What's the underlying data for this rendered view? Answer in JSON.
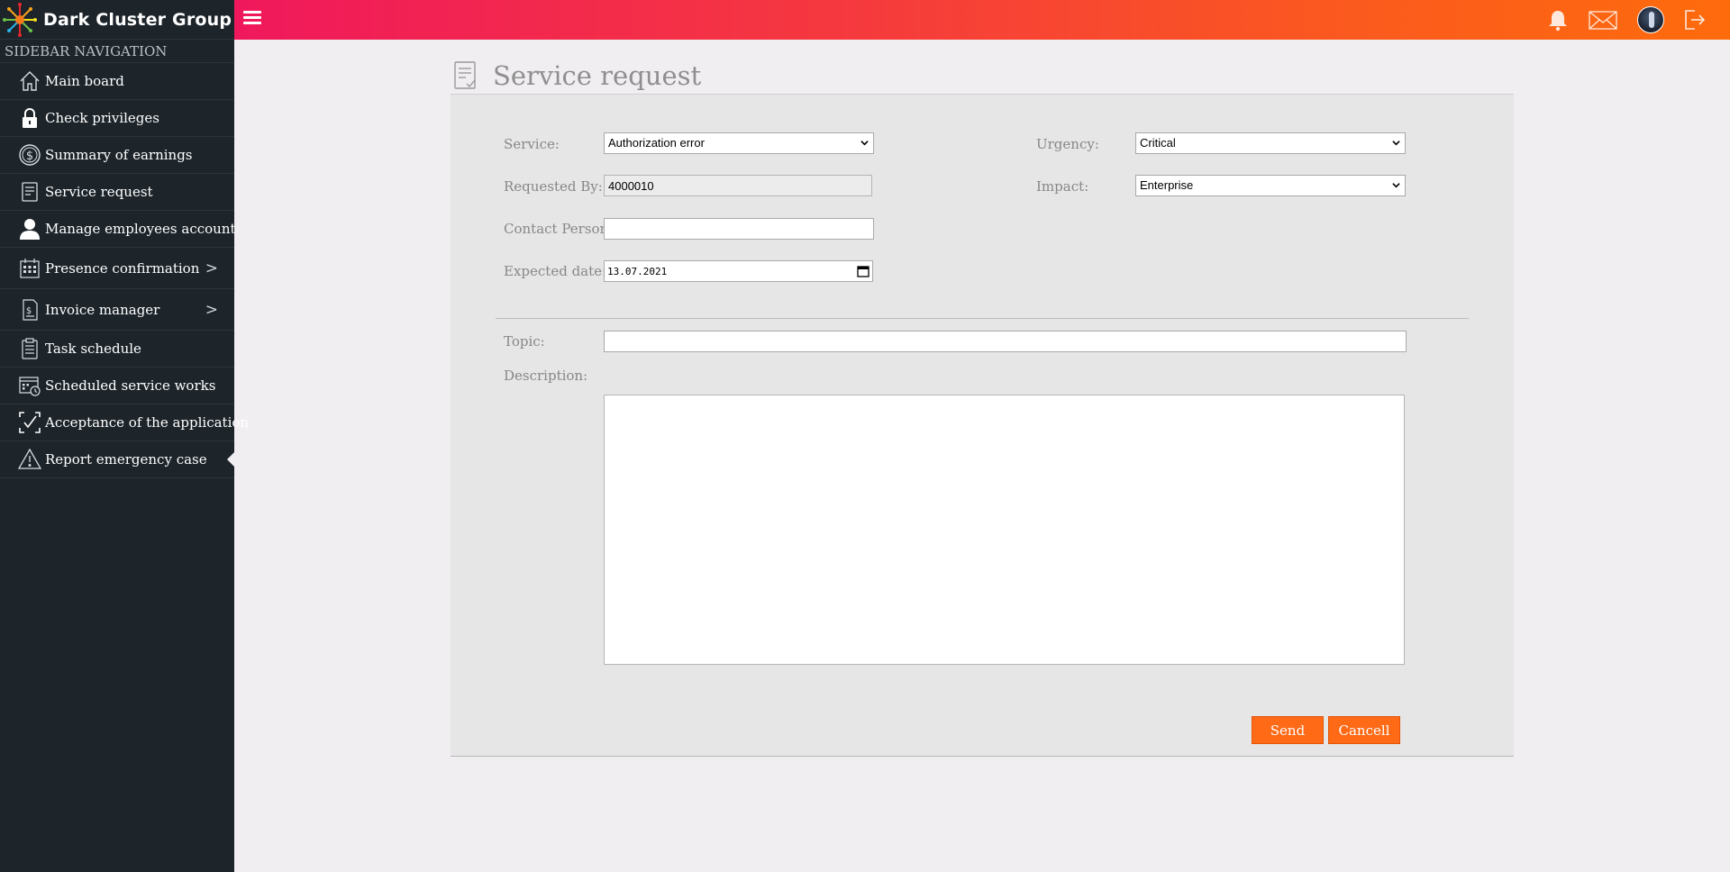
{
  "brand": {
    "name": "Dark Cluster Group",
    "logo_icon": "starburst-logo"
  },
  "sidebar": {
    "heading": "SIDEBAR NAVIGATION",
    "items": [
      {
        "label": "Main board",
        "icon": "home-icon"
      },
      {
        "label": "Check privileges",
        "icon": "lock-icon"
      },
      {
        "label": "Summary of earnings",
        "icon": "dollar-circle-icon"
      },
      {
        "label": "Service request",
        "icon": "document-icon"
      },
      {
        "label": "Manage employees account",
        "icon": "user-icon"
      },
      {
        "label": "Presence confirmation",
        "icon": "calendar-grid-icon",
        "has_submenu": true
      },
      {
        "label": "Invoice manager",
        "icon": "invoice-icon",
        "has_submenu": true
      },
      {
        "label": "Task schedule",
        "icon": "clipboard-icon"
      },
      {
        "label": "Scheduled service works",
        "icon": "calendar-clock-icon"
      },
      {
        "label": "Acceptance of the application",
        "icon": "checkmark-frame-icon"
      },
      {
        "label": "Report emergency case",
        "icon": "warning-triangle-icon",
        "active": true
      }
    ]
  },
  "topbar": {
    "menu_icon": "hamburger-icon",
    "icons": [
      "bell-icon",
      "mail-icon",
      "avatar",
      "logout-icon"
    ]
  },
  "page": {
    "title": "Service request",
    "title_icon": "document-check-icon"
  },
  "form": {
    "service": {
      "label": "Service:",
      "value": "Authorization error",
      "options": [
        "Authorization error"
      ]
    },
    "requested_by": {
      "label": "Requested By:",
      "value": "4000010"
    },
    "contact_person": {
      "label": "Contact Person:",
      "value": ""
    },
    "expected_date": {
      "label": "Expected date:",
      "value": "13.07.2021"
    },
    "urgency": {
      "label": "Urgency:",
      "value": "Critical",
      "options": [
        "Critical"
      ]
    },
    "impact": {
      "label": "Impact:",
      "value": "Enterprise",
      "options": [
        "Enterprise"
      ]
    },
    "topic": {
      "label": "Topic:",
      "value": ""
    },
    "description": {
      "label": "Description:",
      "value": ""
    },
    "send_label": "Send",
    "cancel_label": "Cancell"
  },
  "colors": {
    "sidebar_bg": "#1d252b",
    "topbar_gradient_start": "#f0185c",
    "topbar_gradient_end": "#fe6b0c",
    "button_orange": "#ff6a17",
    "panel_bg": "#e6e6e6",
    "page_bg": "#f1eef1"
  }
}
